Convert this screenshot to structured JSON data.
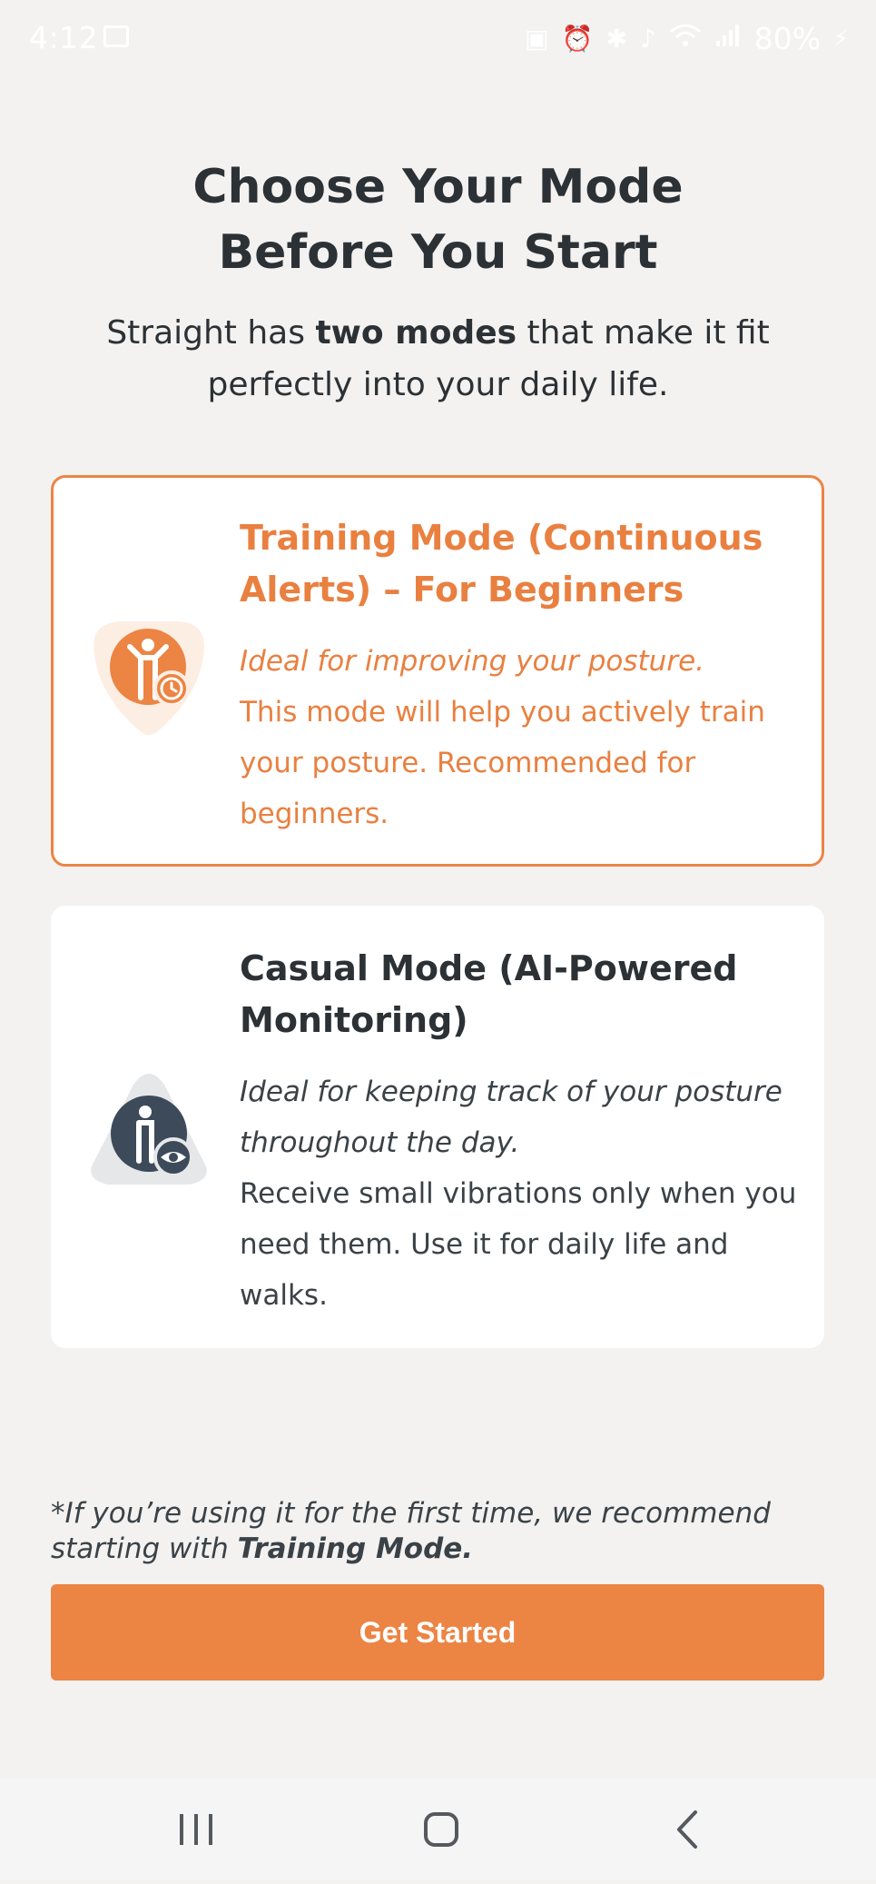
{
  "status_bar": {
    "time": "4:12",
    "battery": "80%",
    "icons": [
      "image-icon",
      "nfc-icon",
      "alarm-icon",
      "bluetooth-icon",
      "mute-icon",
      "wifi-icon",
      "signal-icon",
      "battery-icon"
    ]
  },
  "header": {
    "title_line1": "Choose Your Mode",
    "title_line2": "Before You Start",
    "subtitle_pre": "Straight has ",
    "subtitle_bold": "two modes",
    "subtitle_post": " that make it fit perfectly into your daily life."
  },
  "modes": [
    {
      "title": "Training Mode (Continuous Alerts) – For Beginners",
      "desc_italic": "Ideal for improving your posture.",
      "desc": "This mode will help you actively train your posture. Recommended for beginners.",
      "selected": true,
      "icon": "training-person-timer-icon"
    },
    {
      "title": "Casual Mode (AI-Powered Monitoring)",
      "desc_italic": "Ideal for keeping track of your posture throughout the day.",
      "desc": "Receive small vibrations only when you need them. Use it for daily life and walks.",
      "selected": false,
      "icon": "casual-person-eye-icon"
    }
  ],
  "note": {
    "pre": "*If you’re using it for the first time, we recommend starting with ",
    "bold": "Training Mode."
  },
  "cta": {
    "label": "Get Started"
  },
  "colors": {
    "accent": "#ec8443",
    "background": "#f3f2f1",
    "card": "#ffffff",
    "text_dark": "#2c3135",
    "icon_dark": "#3d4a5a"
  }
}
